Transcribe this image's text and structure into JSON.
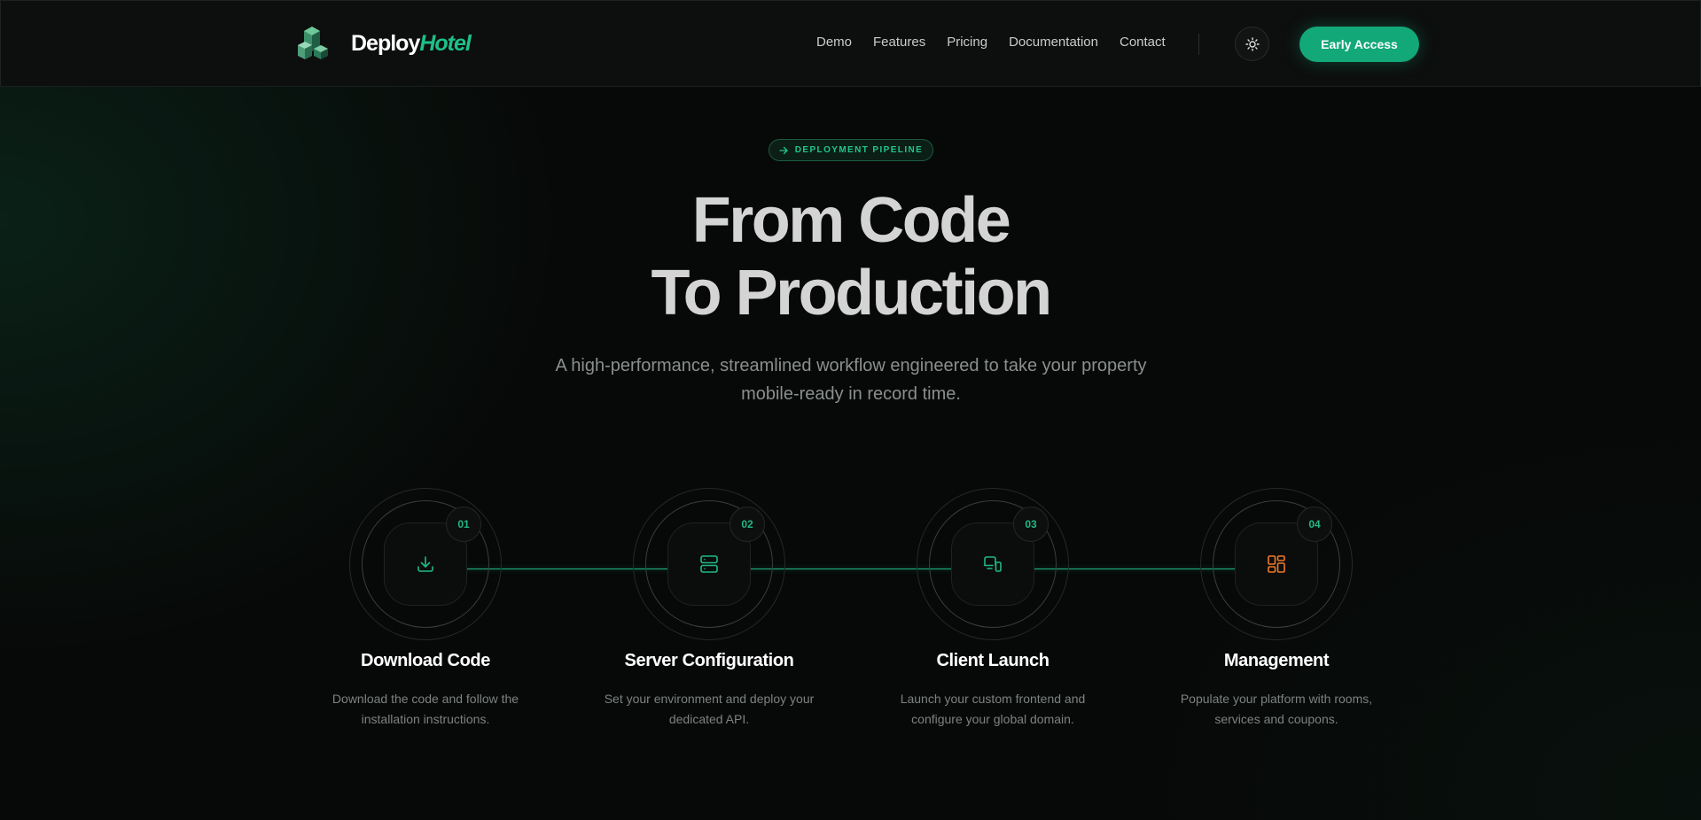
{
  "brand": {
    "name_primary": "Deploy",
    "name_accent": "Hotel",
    "accent_color": "#1ec08a"
  },
  "nav": {
    "links": [
      {
        "label": "Demo"
      },
      {
        "label": "Features"
      },
      {
        "label": "Pricing"
      },
      {
        "label": "Documentation"
      },
      {
        "label": "Contact"
      }
    ],
    "theme_toggle_icon": "sun-icon",
    "cta_label": "Early Access",
    "cta_color": "#13a878"
  },
  "hero": {
    "badge_icon": "arrow-right-icon",
    "badge_label": "DEPLOYMENT PIPELINE",
    "title_line1": "From Code",
    "title_line2": "To Production",
    "subtitle": "A high-performance, streamlined workflow engineered to take your property mobile-ready in record time."
  },
  "steps": [
    {
      "number": "01",
      "title": "Download Code",
      "description": "Download the code and follow the installation instructions.",
      "icon": "download-icon",
      "icon_color": "#1fb984"
    },
    {
      "number": "02",
      "title": "Server Configuration",
      "description": "Set your environment and deploy your dedicated API.",
      "icon": "server-icon",
      "icon_color": "#1fb984"
    },
    {
      "number": "03",
      "title": "Client Launch",
      "description": "Launch your custom frontend and configure your global domain.",
      "icon": "devices-icon",
      "icon_color": "#1fb984"
    },
    {
      "number": "04",
      "title": "Management",
      "description": "Populate your platform with rooms, services and coupons.",
      "icon": "dashboard-icon",
      "icon_color": "#f07a2a"
    }
  ]
}
